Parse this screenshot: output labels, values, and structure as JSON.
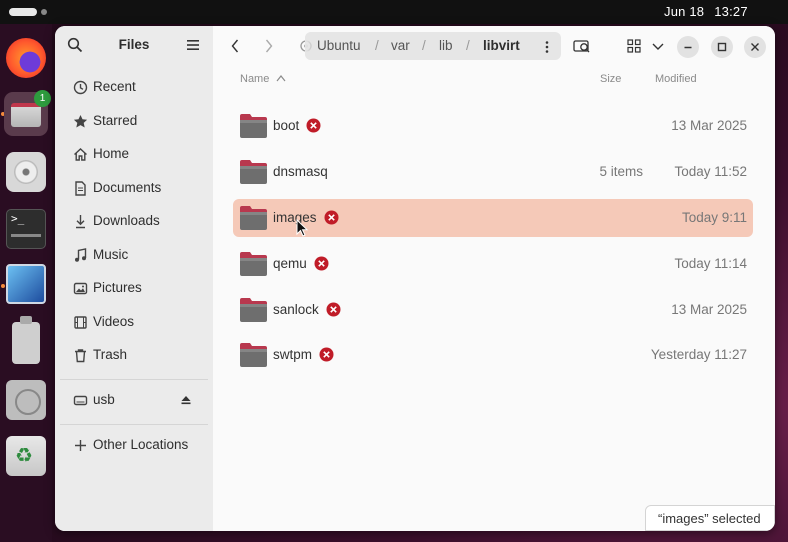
{
  "topbar": {
    "date": "Jun 18",
    "time": "13:27"
  },
  "dock": {
    "items": [
      {
        "name": "firefox",
        "icon": "firefox-icon"
      },
      {
        "name": "files",
        "icon": "files-icon",
        "badge": "1"
      },
      {
        "name": "disk",
        "icon": "disk-icon"
      },
      {
        "name": "terminal",
        "icon": "terminal-icon",
        "glyph": ">_"
      },
      {
        "name": "virtualbox",
        "icon": "virtualbox-icon"
      },
      {
        "name": "usb",
        "icon": "usb-drive-icon"
      },
      {
        "name": "optical",
        "icon": "optical-drive-icon"
      },
      {
        "name": "trash",
        "icon": "trash-recycle-icon"
      }
    ]
  },
  "sidebar": {
    "title": "Files",
    "places": [
      {
        "label": "Recent",
        "icon": "clock-icon"
      },
      {
        "label": "Starred",
        "icon": "star-icon"
      },
      {
        "label": "Home",
        "icon": "home-icon"
      },
      {
        "label": "Documents",
        "icon": "document-icon"
      },
      {
        "label": "Downloads",
        "icon": "download-icon"
      },
      {
        "label": "Music",
        "icon": "music-icon"
      },
      {
        "label": "Pictures",
        "icon": "picture-icon"
      },
      {
        "label": "Videos",
        "icon": "video-icon"
      },
      {
        "label": "Trash",
        "icon": "trash-icon"
      }
    ],
    "devices": [
      {
        "label": "usb",
        "icon": "drive-icon"
      }
    ],
    "other": {
      "label": "Other Locations",
      "icon": "plus-icon"
    }
  },
  "pathbar": {
    "segments": [
      "Ubuntu",
      "var",
      "lib",
      "libvirt"
    ],
    "separator": "/"
  },
  "columns": {
    "name": "Name",
    "size": "Size",
    "modified": "Modified"
  },
  "files": [
    {
      "name": "boot",
      "size": "",
      "modified": "13 Mar 2025",
      "error": true
    },
    {
      "name": "dnsmasq",
      "size": "5 items",
      "modified": "Today 11:52",
      "error": false
    },
    {
      "name": "images",
      "size": "",
      "modified": "Today 9:11",
      "error": true,
      "selected": true
    },
    {
      "name": "qemu",
      "size": "",
      "modified": "Today 11:14",
      "error": true
    },
    {
      "name": "sanlock",
      "size": "",
      "modified": "13 Mar 2025",
      "error": true
    },
    {
      "name": "swtpm",
      "size": "",
      "modified": "Yesterday 11:27",
      "error": true
    }
  ],
  "status": "“images” selected",
  "colors": {
    "selection": "#f5c9b8",
    "folder_tab": "#b8384e",
    "error": "#c01c28",
    "accent": "#e95420"
  }
}
